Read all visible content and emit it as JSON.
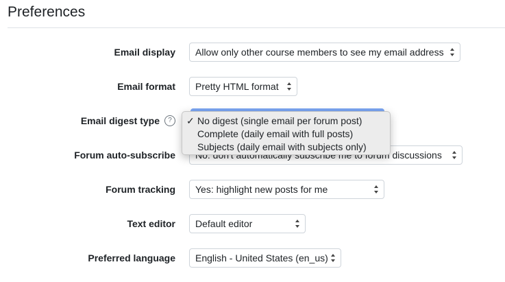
{
  "page": {
    "title": "Preferences"
  },
  "fields": {
    "email_display": {
      "label": "Email display",
      "value": "Allow only other course members to see my email address"
    },
    "email_format": {
      "label": "Email format",
      "value": "Pretty HTML format"
    },
    "email_digest_type": {
      "label": "Email digest type",
      "help_icon": "?",
      "options": [
        "No digest (single email per forum post)",
        "Complete (daily email with full posts)",
        "Subjects (daily email with subjects only)"
      ],
      "selected_index": 0,
      "check_mark": "✓"
    },
    "forum_auto_subscribe": {
      "label": "Forum auto-subscribe",
      "value": "No: don't automatically subscribe me to forum discussions"
    },
    "forum_tracking": {
      "label": "Forum tracking",
      "value": "Yes: highlight new posts for me"
    },
    "text_editor": {
      "label": "Text editor",
      "value": "Default editor"
    },
    "preferred_language": {
      "label": "Preferred language",
      "value": "English - United States (en_us)"
    }
  },
  "colors": {
    "focus": "#5a8ff0",
    "border": "#ced4da",
    "menu_bg": "#ececec"
  }
}
